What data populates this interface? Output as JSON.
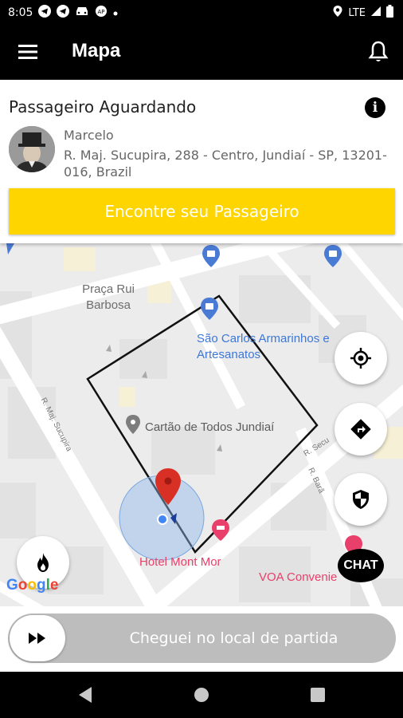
{
  "status_bar": {
    "time": "8:05",
    "network": "LTE"
  },
  "app_bar": {
    "title": "Mapa"
  },
  "passenger_card": {
    "title": "Passageiro Aguardando",
    "name": "Marcelo",
    "address": "R. Maj. Sucupira, 288 - Centro, Jundiaí - SP, 13201-016, Brazil",
    "find_button_label": "Encontre seu Passageiro"
  },
  "map": {
    "labels": {
      "praca": "Praça Rui Barbosa",
      "sao_carlos": "São Carlos Armarinhos e Artesanatos",
      "cartao": "Cartão de Todos Jundiaí",
      "hotel": "Hotel Mont Mor",
      "voa": "VOA Convenie",
      "street_sucupira": "R. Maj. Sucupira",
      "street_secu": "R. Secu",
      "street_bar": "R. Barã"
    },
    "attribution": "Google"
  },
  "chat_label": "CHAT",
  "slider": {
    "label": "Cheguei no local de partida"
  },
  "colors": {
    "accent_yellow": "#ffd500",
    "map_blue": "#4a7bd4",
    "pink": "#e8406a",
    "pin_red": "#d93025"
  }
}
